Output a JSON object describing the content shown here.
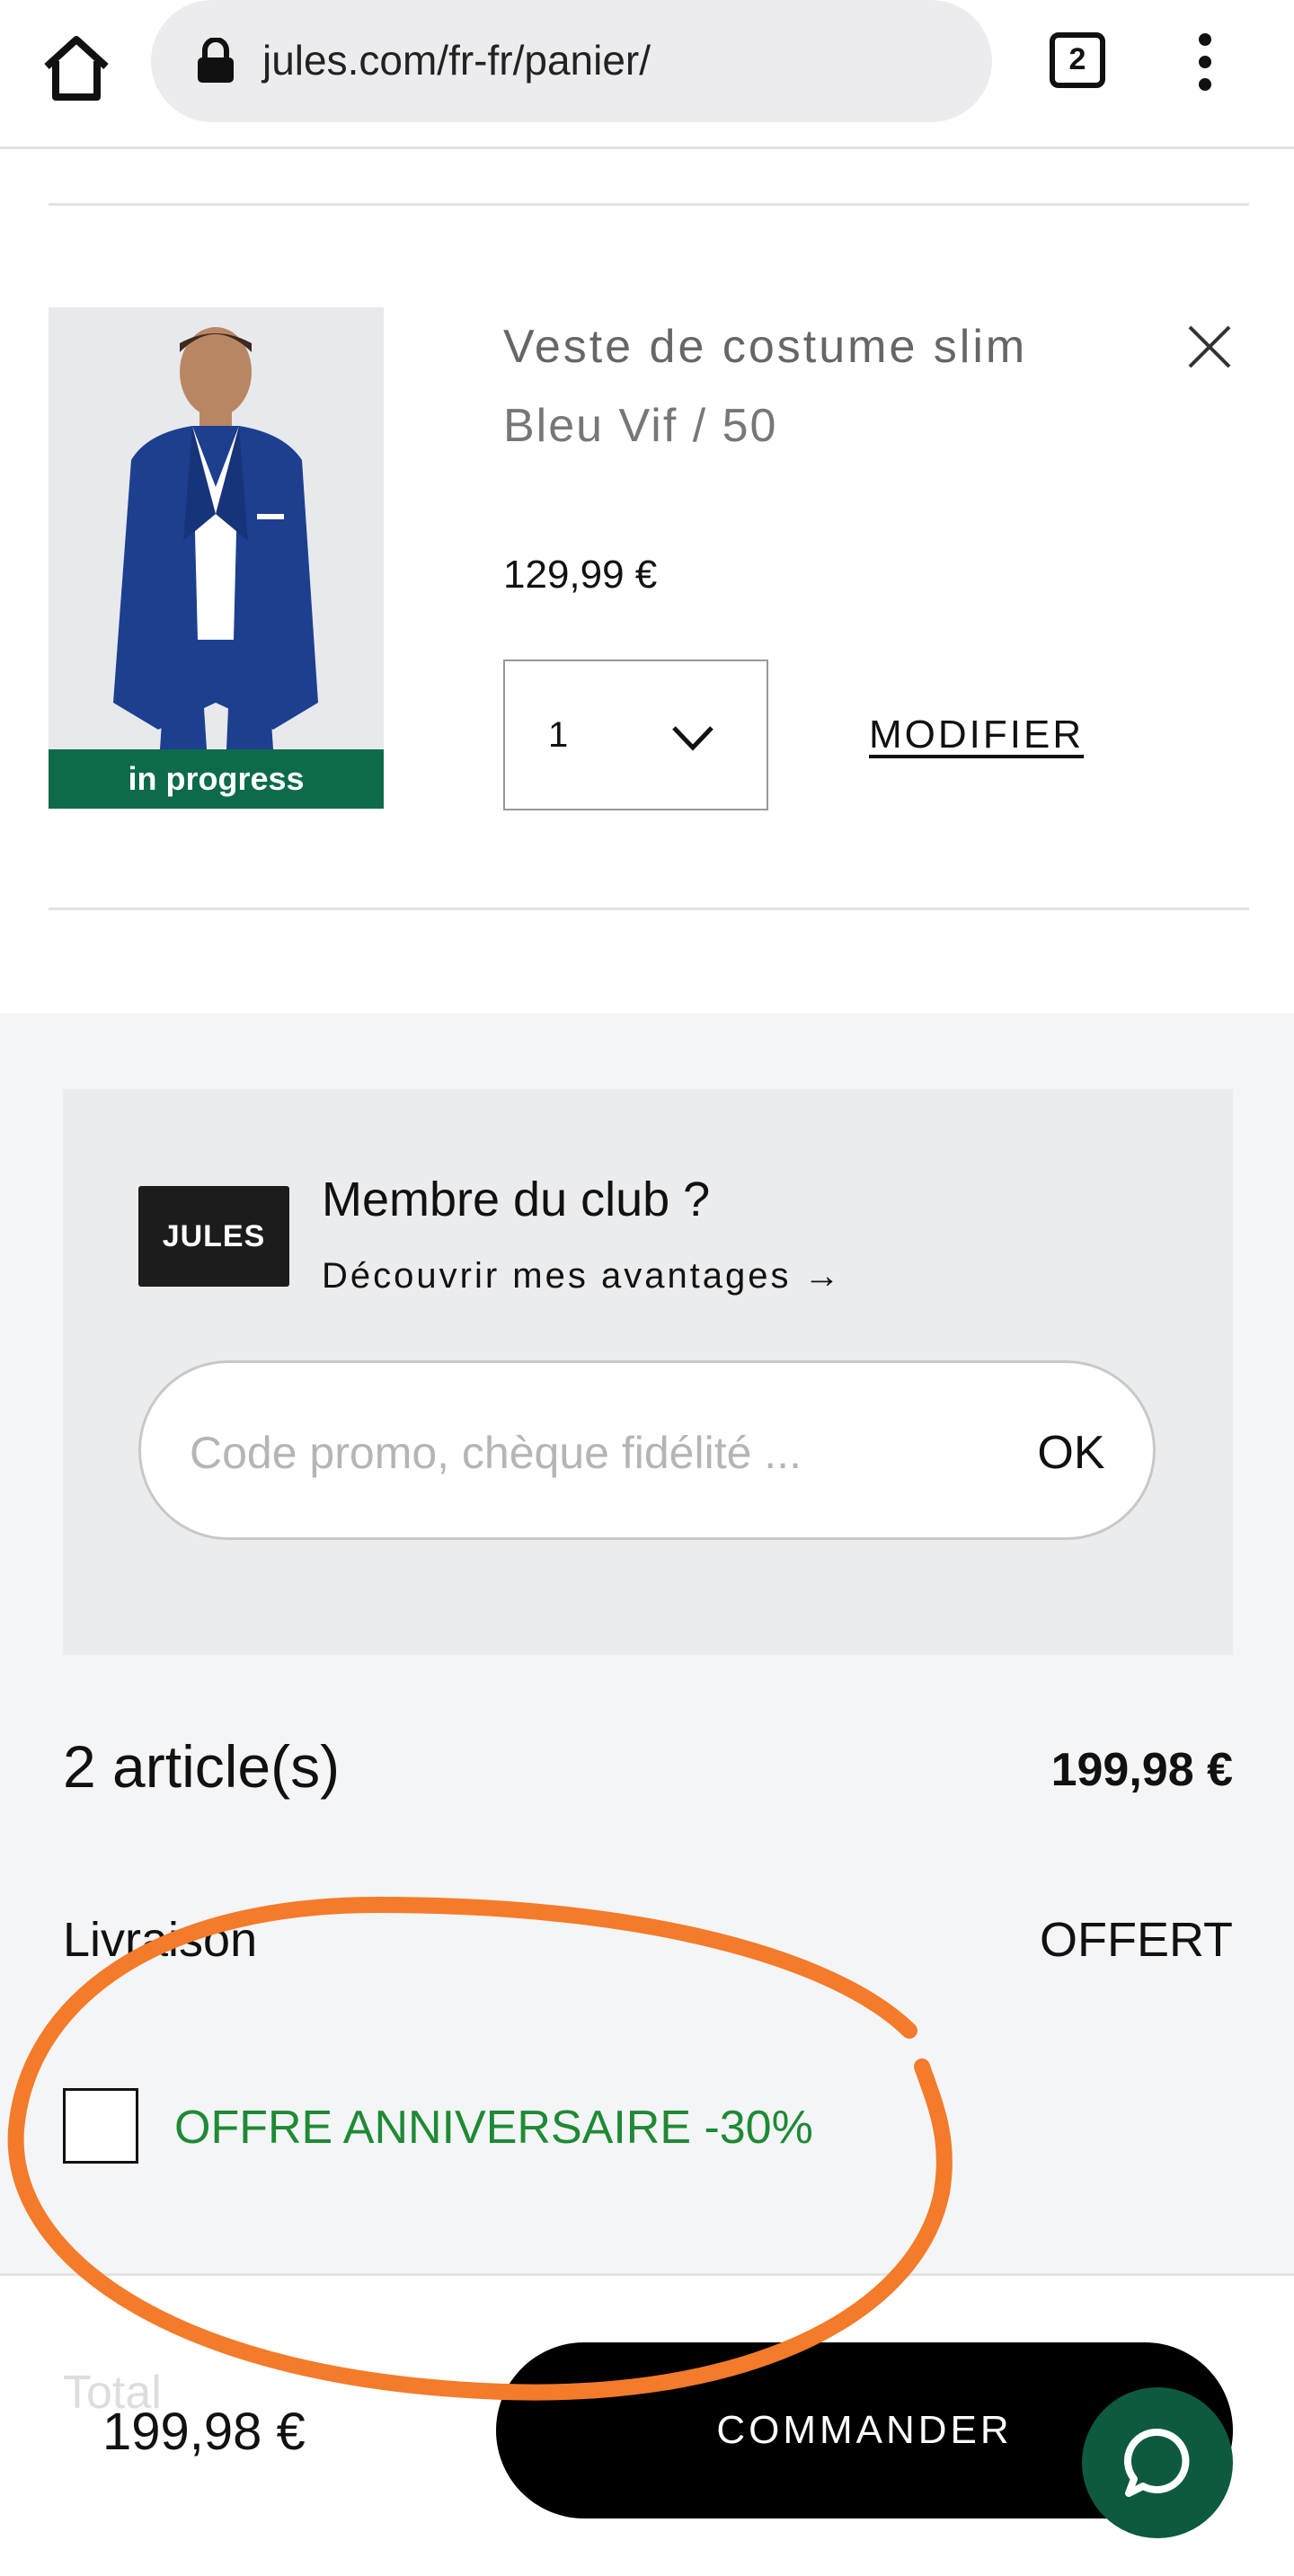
{
  "browser": {
    "url": "jules.com/fr-fr/panier/",
    "tab_count": "2",
    "icons": [
      "home-icon",
      "lock-icon",
      "tabs-icon",
      "menu-icon"
    ]
  },
  "cart_item": {
    "name": "Veste de costume slim",
    "variant": "Bleu Vif / 50",
    "price": "129,99 €",
    "quantity": "1",
    "modify_label": "MODIFIER",
    "image_badge": "in progress",
    "icons": [
      "close-icon",
      "chevron-down-icon"
    ]
  },
  "club": {
    "logo_text": "JULES",
    "title": "Membre du club ?",
    "link": "Découvrir mes avantages →",
    "promo_placeholder": "Code promo, chèque fidélité ...",
    "ok_label": "OK"
  },
  "summary": {
    "articles_label": "2 article(s)",
    "articles_total": "199,98 €",
    "delivery_label": "Livraison",
    "delivery_value": "OFFERT",
    "offer_label": "OFFRE ANNIVERSAIRE -30%",
    "offer_checked": false
  },
  "footer": {
    "total_label": "Total",
    "total_value": "199,98 €",
    "order_label": "COMMANDER",
    "icons": [
      "chat-icon"
    ]
  },
  "colors": {
    "offer_green": "#1e8a34",
    "badge_green": "#0d6b4a",
    "chat_green": "#0d5a3f",
    "annotation_orange": "#f47b2a",
    "summary_bg": "#f4f5f7"
  }
}
